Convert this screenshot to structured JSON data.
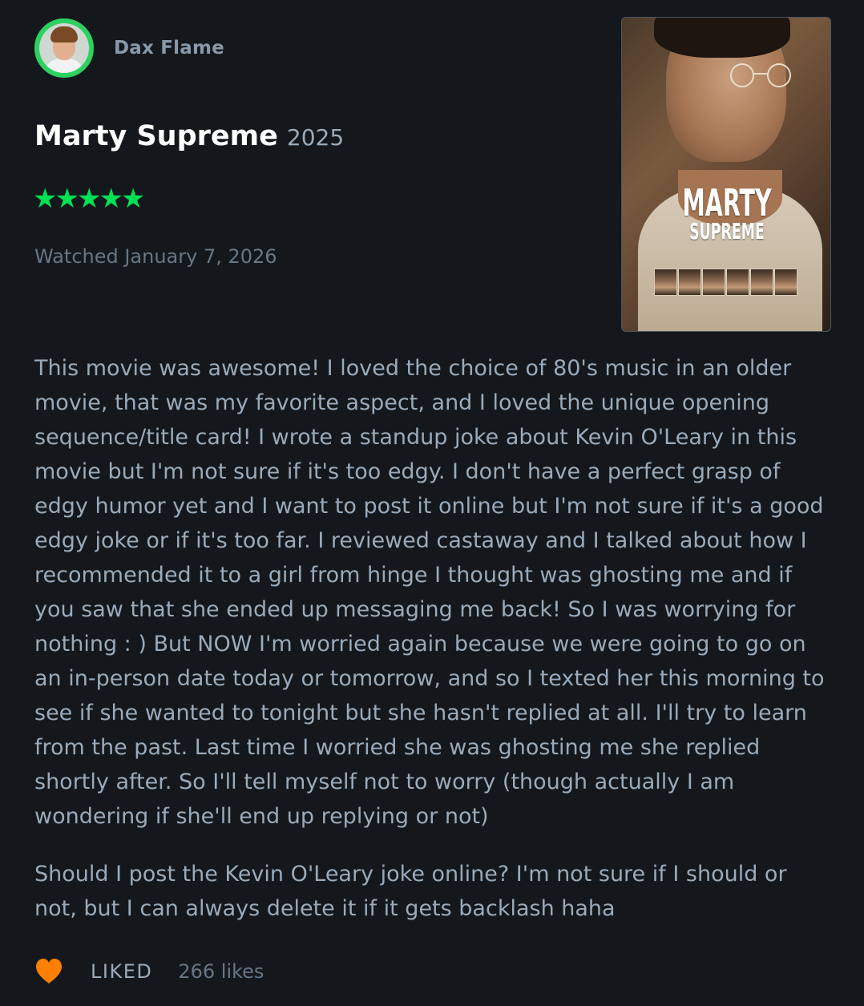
{
  "reviewer": {
    "name": "Dax Flame"
  },
  "film": {
    "title": "Marty Supreme",
    "year": "2025",
    "poster_title_line1": "MARTY",
    "poster_title_line2": "SUPREME"
  },
  "rating": {
    "stars_text": "★★★★★",
    "value": 5,
    "max": 5,
    "color": "#00e054"
  },
  "watched": "Watched January 7, 2026",
  "review": {
    "paragraphs": [
      "This movie was awesome! I loved the choice of 80's music in an older movie, that was my favorite aspect, and I loved the unique opening sequence/title card! I wrote a standup joke about Kevin O'Leary in this movie but I'm not sure if it's too edgy. I don't have a perfect grasp of edgy humor yet and I want to post it online but I'm not sure if it's a good edgy joke or if it's too far. I reviewed castaway and I talked about how I recommended it to a girl from hinge I thought was ghosting me and if you saw that she ended up messaging me back! So I was worrying for nothing : ) But NOW I'm worried again because we were going to go on an in-person date today or tomorrow, and so I texted her this morning to see if she wanted to tonight but she hasn't replied at all. I'll try to learn from the past. Last time I worried she was ghosting me she replied shortly after. So I'll tell myself not to worry (though actually I am wondering if she'll end up replying or not)",
      "Should I post the Kevin O'Leary joke online? I'm not sure if I should or not, but I can always delete it if it gets backlash haha"
    ]
  },
  "actions": {
    "liked_label": "LIKED",
    "likes_count": "266 likes",
    "heart_color": "#ff8000"
  }
}
